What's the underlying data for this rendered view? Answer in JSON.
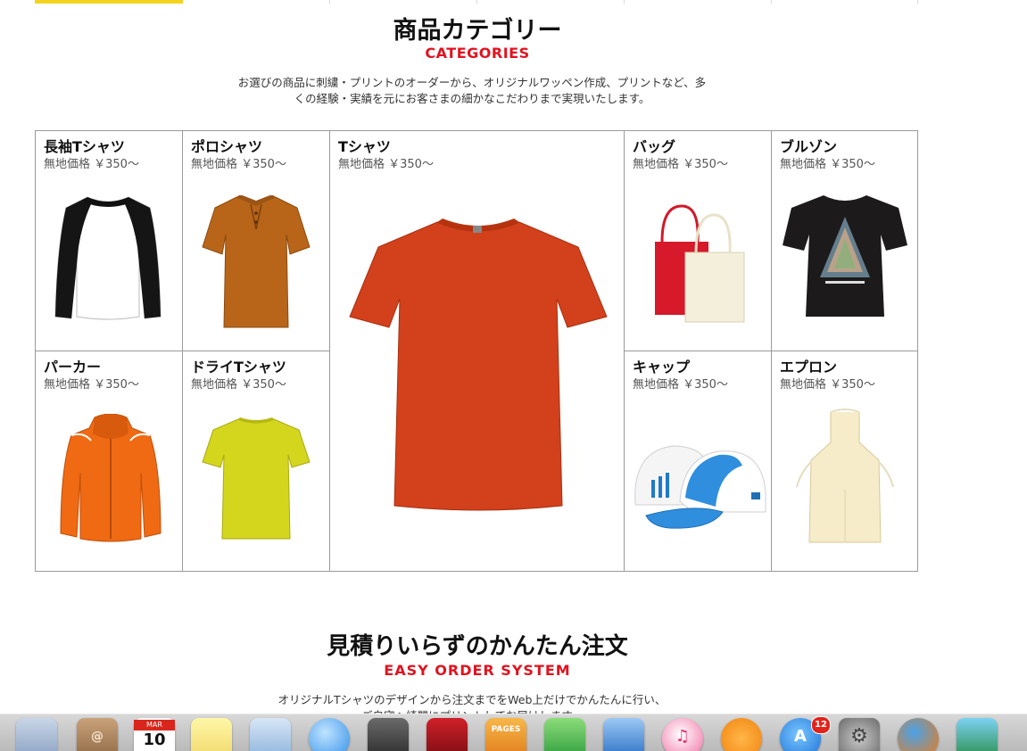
{
  "categories_section": {
    "title": "商品カテゴリー",
    "subtitle": "CATEGORIES",
    "description_line1": "お選びの商品に刺繍・プリントのオーダーから、オリジナルワッペン作成、プリントなど、多",
    "description_line2": "くの経験・実績を元にお客さまの細かなこだわりまで実現いたします。"
  },
  "products": [
    {
      "name": "長袖Tシャツ",
      "price": "無地価格 ￥350〜",
      "icon": "raglan-long-sleeve-shirt"
    },
    {
      "name": "ポロシャツ",
      "price": "無地価格 ￥350〜",
      "icon": "polo-shirt"
    },
    {
      "name": "Tシャツ",
      "price": "無地価格 ￥350〜",
      "icon": "t-shirt"
    },
    {
      "name": "バッグ",
      "price": "無地価格 ￥350〜",
      "icon": "tote-bags"
    },
    {
      "name": "ブルゾン",
      "price": "無地価格 ￥350〜",
      "icon": "printed-black-shirt"
    },
    {
      "name": "パーカー",
      "price": "無地価格 ￥350〜",
      "icon": "zip-hoodie"
    },
    {
      "name": "ドライTシャツ",
      "price": "無地価格 ￥350〜",
      "icon": "dry-t-shirt"
    },
    {
      "name": "キャップ",
      "price": "無地価格 ￥350〜",
      "icon": "caps"
    },
    {
      "name": "エプロン",
      "price": "無地価格 ￥350〜",
      "icon": "apron"
    }
  ],
  "order_section": {
    "title": "見積りいらずのかんたん注文",
    "subtitle": "EASY ORDER SYSTEM",
    "description_line1": "オリジナルTシャツのデザインから注文までをWeb上だけでかんたんに行い、",
    "description_line2": "ご自宅へ綺麗にプリントしてお届けします。"
  },
  "dock": {
    "calendar_month": "MAR",
    "calendar_day": "10",
    "app_store_badge": "12",
    "pages_label": "PAGES",
    "icons": [
      "mail-icon",
      "contacts-icon",
      "calendar-icon",
      "notes-icon",
      "preview-icon",
      "messages-icon",
      "facetime-icon",
      "photo-booth-icon",
      "pages-icon",
      "numbers-icon",
      "keynote-icon",
      "itunes-icon",
      "ibooks-icon",
      "app-store-icon",
      "system-preferences-icon",
      "firefox-icon",
      "iphoto-icon"
    ]
  },
  "colors": {
    "accent_red": "#e1131f",
    "tab_yellow": "#f4d31f",
    "grid_border": "#9a9a9a"
  }
}
